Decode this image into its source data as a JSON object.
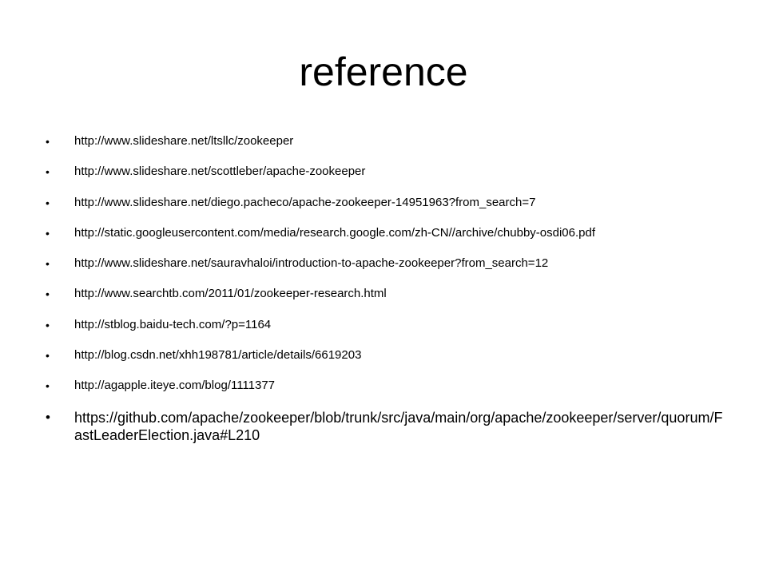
{
  "slide": {
    "title": "reference",
    "bullet_glyph": "•",
    "references": [
      "http://www.slideshare.net/ltsllc/zookeeper",
      "http://www.slideshare.net/scottleber/apache-zookeeper",
      "http://www.slideshare.net/diego.pacheco/apache-zookeeper-14951963?from_search=7",
      "http://static.googleusercontent.com/media/research.google.com/zh-CN//archive/chubby-osdi06.pdf",
      "http://www.slideshare.net/sauravhaloi/introduction-to-apache-zookeeper?from_search=12",
      "http://www.searchtb.com/2011/01/zookeeper-research.html",
      "http://stblog.baidu-tech.com/?p=1164",
      "http://blog.csdn.net/xhh198781/article/details/6619203",
      "http://agapple.iteye.com/blog/1111377",
      "https://github.com/apache/zookeeper/blob/trunk/src/java/main/org/apache/zookeeper/server/quorum/FastLeaderElection.java#L210"
    ]
  }
}
